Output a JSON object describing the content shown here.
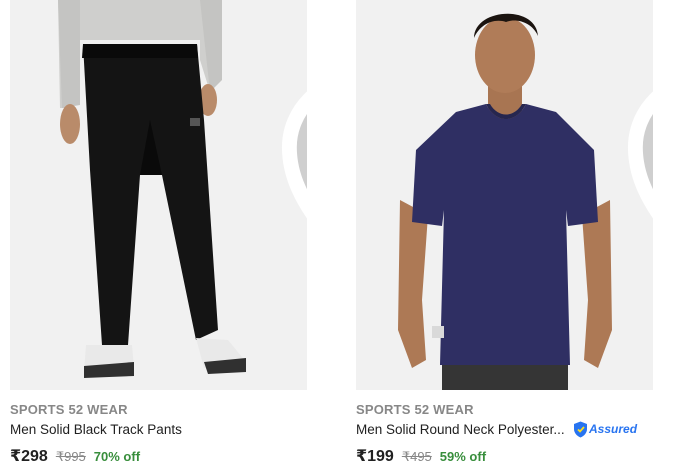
{
  "products": [
    {
      "brand": "SPORTS 52 WEAR",
      "title": "Men Solid Black Track Pants",
      "price": "₹298",
      "mrp": "₹995",
      "discount": "70% off",
      "image_icon": "black-track-pants-photo",
      "assured": false
    },
    {
      "brand": "SPORTS 52 WEAR",
      "title": "Men Solid Round Neck Polyester...",
      "price": "₹199",
      "mrp": "₹495",
      "discount": "59% off",
      "image_icon": "navy-tshirt-model-photo",
      "assured": true,
      "assured_label": "Assured"
    }
  ],
  "colors": {
    "discount_green": "#388e3c",
    "brand_grey": "#878787",
    "assured_blue": "#2874f0",
    "wishlist_heart": "#cfcfcf"
  }
}
